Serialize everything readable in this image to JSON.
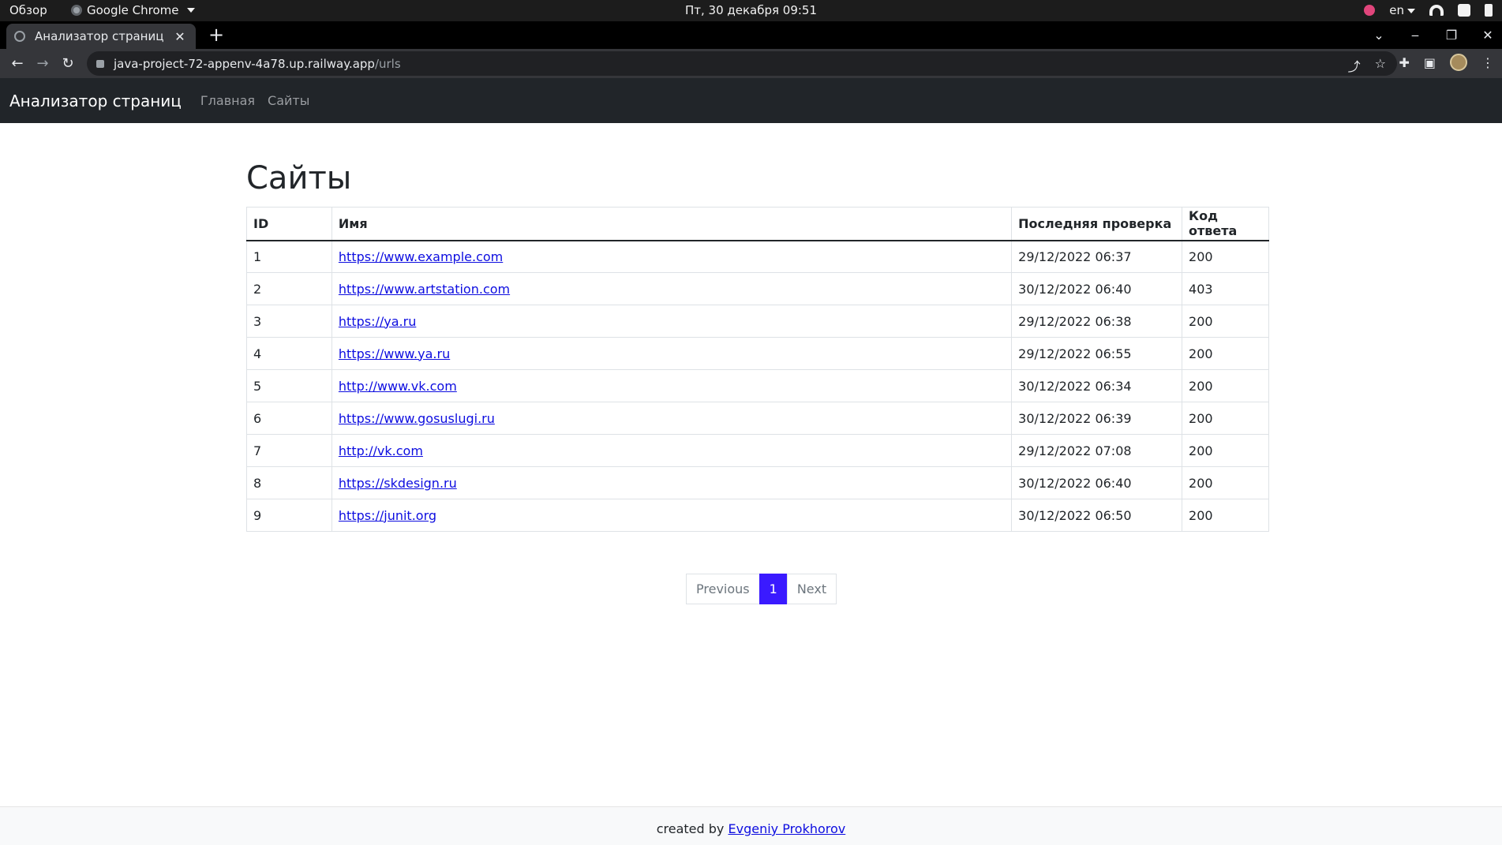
{
  "os": {
    "overview": "Обзор",
    "app": "Google Chrome",
    "clock": "Пт, 30 декабря  09:51",
    "lang": "en"
  },
  "browser": {
    "tab_title": "Анализатор страниц",
    "tab_close": "✕",
    "new_tab": "+",
    "url_host": "java-project-72-appenv-4a78.up.railway.app",
    "url_path": "/urls",
    "win_min": "‒",
    "win_max": "❐",
    "win_close": "✕",
    "back": "←",
    "forward": "→",
    "reload": "↻"
  },
  "navbar": {
    "brand": "Анализатор страниц",
    "links": [
      "Главная",
      "Сайты"
    ]
  },
  "page": {
    "title": "Сайты",
    "table": {
      "headers": [
        "ID",
        "Имя",
        "Последняя проверка",
        "Код ответа"
      ],
      "rows": [
        {
          "id": "1",
          "name": "https://www.example.com",
          "last_check": "29/12/2022 06:37",
          "code": "200"
        },
        {
          "id": "2",
          "name": "https://www.artstation.com",
          "last_check": "30/12/2022 06:40",
          "code": "403"
        },
        {
          "id": "3",
          "name": "https://ya.ru",
          "last_check": "29/12/2022 06:38",
          "code": "200"
        },
        {
          "id": "4",
          "name": "https://www.ya.ru",
          "last_check": "29/12/2022 06:55",
          "code": "200"
        },
        {
          "id": "5",
          "name": "http://www.vk.com",
          "last_check": "30/12/2022 06:34",
          "code": "200"
        },
        {
          "id": "6",
          "name": "https://www.gosuslugi.ru",
          "last_check": "30/12/2022 06:39",
          "code": "200"
        },
        {
          "id": "7",
          "name": "http://vk.com",
          "last_check": "29/12/2022 07:08",
          "code": "200"
        },
        {
          "id": "8",
          "name": "https://skdesign.ru",
          "last_check": "30/12/2022 06:40",
          "code": "200"
        },
        {
          "id": "9",
          "name": "https://junit.org",
          "last_check": "30/12/2022 06:50",
          "code": "200"
        }
      ]
    },
    "pagination": {
      "previous": "Previous",
      "current": "1",
      "next": "Next"
    }
  },
  "footer": {
    "prefix": "created by ",
    "author": "Evgeniy Prokhorov"
  },
  "colors": {
    "navbar_bg": "#212529",
    "link": "#0d0de0",
    "active_page": "#3a1aff"
  }
}
